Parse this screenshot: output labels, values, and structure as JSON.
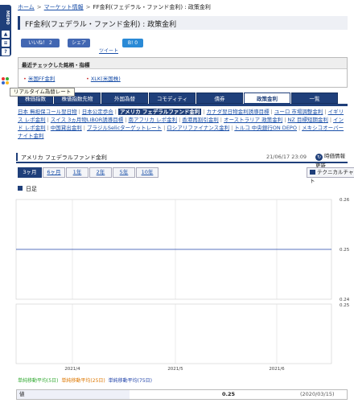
{
  "breadcrumb": {
    "home": "ホーム",
    "market": "マーケット情報",
    "current": "FF金利(フェデラル・ファンド金利) : 政策金利"
  },
  "page_title": "FF金利(フェデラル・ファンド金利) : 政策金利",
  "side": {
    "memo": "MEMO",
    "up": "▲",
    "list": "≡",
    "help": "?"
  },
  "social": {
    "like": "いいね！ 2",
    "share": "シェア",
    "hatena": "B! 0",
    "tweet": "ツイート"
  },
  "recent": {
    "heading": "最近チェックした銘柄・指標",
    "items": [
      "米国FF金利",
      "XLK(米国株)"
    ]
  },
  "tooltip": "リアルタイム為替レート",
  "tabs": [
    "株価指数",
    "株価指数先物",
    "外国為替",
    "コモディティ",
    "債券",
    "政策金利",
    "一覧"
  ],
  "active_tab_index": 5,
  "rate_links": [
    "日本 無担保コール翌日物",
    "日本公定歩合",
    "アメリカ フェデラルファンド金利",
    "カナダ翌日物金利誘導目標",
    "ユーロ 市場調整金利",
    "イギリス レポ金利",
    "スイス 3ヵ月物LIBOR誘導目標",
    "南アフリカ レポ金利",
    "香港再割引金利",
    "オーストラリア 政策金利",
    "NZ 目標短期金利",
    "インド レポ金利",
    "中国貸出金利",
    "ブラジルSelicターゲットレート",
    "ロシアリファイナンス金利",
    "トルコ 中央銀行ON DEPO",
    "メキシコオーバーナイト金利"
  ],
  "active_link_index": 2,
  "chart_header": {
    "title": "アメリカ フェデラルファンド金利",
    "datetime": "21/06/17 23:09",
    "update_button": "時価情報更新"
  },
  "periods": [
    "3ヶ月",
    "6ヶ月",
    "1年",
    "2年",
    "5年",
    "10年"
  ],
  "active_period_index": 0,
  "tech_chart_button": "テクニカルチャート",
  "daily_label": "日足",
  "legend": [
    {
      "label": "単純移動平均(5日)",
      "color": "#33aa33"
    },
    {
      "label": "単純移動平均(25日)",
      "color": "#dd7700"
    },
    {
      "label": "単純移動平均(75日)",
      "color": "#2244aa"
    }
  ],
  "value_row": {
    "label": "値",
    "value": "0.25",
    "date": "(2020/03/15)"
  },
  "chart_data": {
    "type": "line",
    "title": "",
    "x_ticks": [
      "2021/4",
      "2021/5",
      "2021/6"
    ],
    "y_ticks_main": [
      "0.26",
      "0.25",
      "0.24"
    ],
    "ylim": [
      0.24,
      0.26
    ],
    "series": [
      {
        "values": [
          0.25,
          0.25,
          0.25,
          0.25
        ],
        "x": [
          "2021/3/17",
          "2021/4",
          "2021/5",
          "2021/6/17"
        ]
      }
    ],
    "lower_panel_y_tick": "0.25",
    "grid": true
  }
}
